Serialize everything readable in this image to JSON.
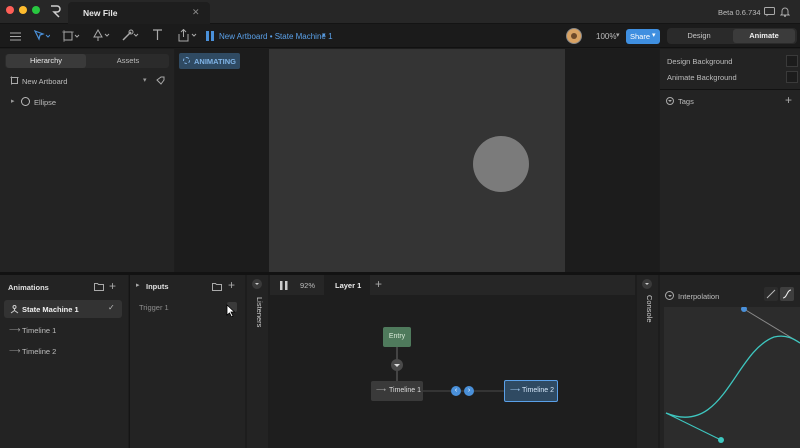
{
  "window": {
    "tab_title": "New File",
    "version": "Beta 0.6.734"
  },
  "toolbar": {
    "artboard_path": "New Artboard • State Machine 1",
    "zoom": "100%",
    "share_label": "Share",
    "mode_design": "Design",
    "mode_animate": "Animate"
  },
  "left_panel": {
    "tabs": [
      "Hierarchy",
      "Assets"
    ],
    "artboard_label": "New Artboard",
    "items": [
      "Ellipse"
    ]
  },
  "canvas": {
    "mode_badge": "ANIMATING"
  },
  "right_panel": {
    "design_background": "Design Background",
    "animate_background": "Animate Background",
    "tags_label": "Tags"
  },
  "animations": {
    "title": "Animations",
    "items": [
      "State Machine 1",
      "Timeline 1",
      "Timeline 2"
    ]
  },
  "inputs": {
    "title": "Inputs",
    "items": [
      "Trigger 1"
    ]
  },
  "listeners_label": "Listeners",
  "console_label": "Console",
  "graph": {
    "zoom": "92%",
    "layer_tab": "Layer 1",
    "entry": "Entry",
    "state_1": "Timeline 1",
    "state_2": "Timeline 2"
  },
  "interpolation": {
    "title": "Interpolation"
  },
  "colors": {
    "accent": "#4a90d9",
    "share_bg": "#3f8fe0",
    "badge_bg": "#2f4a62",
    "entry_node": "#4f7a5c",
    "curve": "#3ec7c0"
  }
}
